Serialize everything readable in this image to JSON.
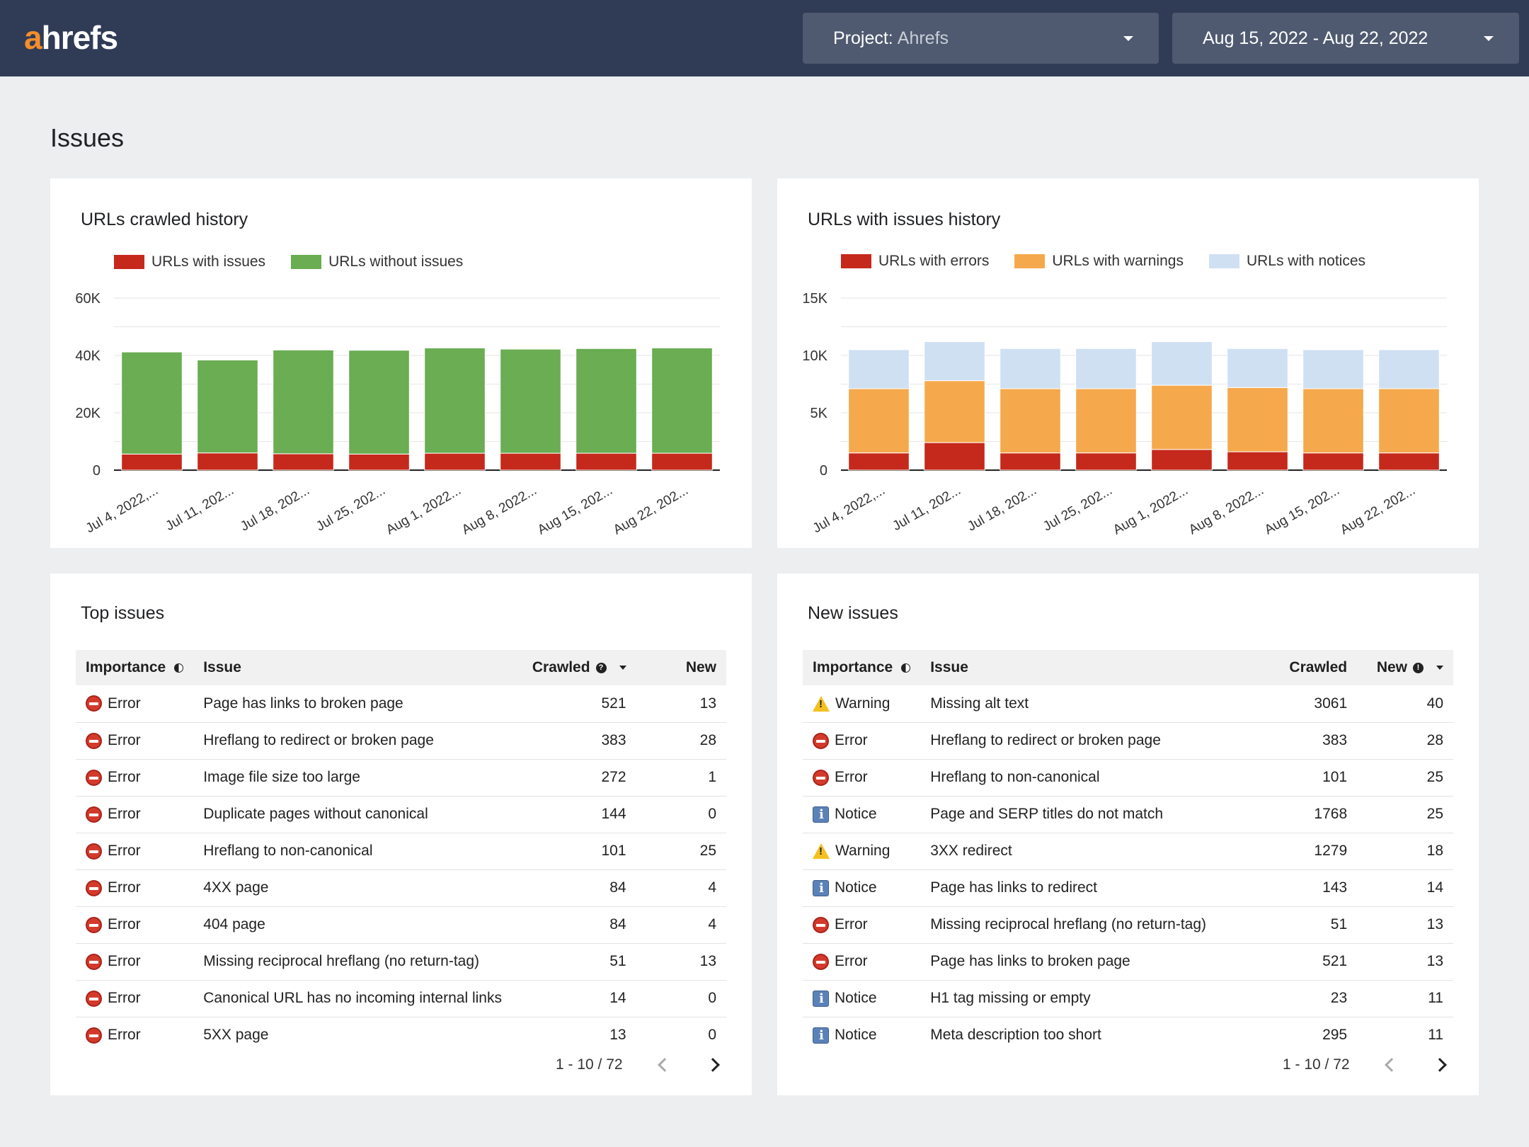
{
  "header": {
    "logo_accent": "a",
    "logo_rest": "hrefs",
    "project_label": "Project:",
    "project_value": "Ahrefs",
    "date_range": "Aug 15, 2022 - Aug 22, 2022"
  },
  "page_title": "Issues",
  "crawled_chart": {
    "title": "URLs crawled history",
    "chart_data": {
      "type": "bar",
      "stacked": true,
      "categories": [
        "Jul 4, 2022,...",
        "Jul 11, 202...",
        "Jul 18, 202...",
        "Jul 25, 202...",
        "Aug 1, 2022...",
        "Aug 8, 2022...",
        "Aug 15, 202...",
        "Aug 22, 202..."
      ],
      "series": [
        {
          "name": "URLs with issues",
          "color": "#c5291c",
          "values": [
            5600,
            6000,
            5700,
            5600,
            5900,
            5900,
            5900,
            5900
          ]
        },
        {
          "name": "URLs without issues",
          "color": "#6aad52",
          "values": [
            35600,
            32400,
            36200,
            36200,
            36700,
            36300,
            36500,
            36700
          ]
        }
      ],
      "yticks": [
        "0",
        "20K",
        "40K",
        "60K"
      ],
      "ylim": [
        0,
        60000
      ],
      "grid": true,
      "legend": "top-left"
    }
  },
  "issues_chart": {
    "title": "URLs with issues history",
    "chart_data": {
      "type": "bar",
      "stacked": true,
      "categories": [
        "Jul 4, 2022,...",
        "Jul 11, 202...",
        "Jul 18, 202...",
        "Jul 25, 202...",
        "Aug 1, 2022...",
        "Aug 8, 2022...",
        "Aug 15, 202...",
        "Aug 22, 202..."
      ],
      "series": [
        {
          "name": "URLs with errors",
          "color": "#c5291c",
          "values": [
            1500,
            2400,
            1500,
            1500,
            1800,
            1600,
            1500,
            1500
          ]
        },
        {
          "name": "URLs with warnings",
          "color": "#f5a94c",
          "values": [
            5600,
            5400,
            5600,
            5600,
            5600,
            5600,
            5600,
            5600
          ]
        },
        {
          "name": "URLs with notices",
          "color": "#cfe0f3",
          "values": [
            3400,
            3400,
            3500,
            3500,
            3800,
            3400,
            3400,
            3400
          ]
        }
      ],
      "yticks": [
        "0",
        "5K",
        "10K",
        "15K"
      ],
      "ylim": [
        0,
        15000
      ],
      "grid": true,
      "legend": "top-left"
    }
  },
  "top_issues": {
    "title": "Top issues",
    "columns": {
      "importance": "Importance",
      "issue": "Issue",
      "crawled": "Crawled",
      "new": "New"
    },
    "rows": [
      {
        "severity": "error",
        "importance": "Error",
        "issue": "Page has links to broken page",
        "crawled": "521",
        "new": "13"
      },
      {
        "severity": "error",
        "importance": "Error",
        "issue": "Hreflang to redirect or broken page",
        "crawled": "383",
        "new": "28"
      },
      {
        "severity": "error",
        "importance": "Error",
        "issue": "Image file size too large",
        "crawled": "272",
        "new": "1"
      },
      {
        "severity": "error",
        "importance": "Error",
        "issue": "Duplicate pages without canonical",
        "crawled": "144",
        "new": "0"
      },
      {
        "severity": "error",
        "importance": "Error",
        "issue": "Hreflang to non-canonical",
        "crawled": "101",
        "new": "25"
      },
      {
        "severity": "error",
        "importance": "Error",
        "issue": "4XX page",
        "crawled": "84",
        "new": "4"
      },
      {
        "severity": "error",
        "importance": "Error",
        "issue": "404 page",
        "crawled": "84",
        "new": "4"
      },
      {
        "severity": "error",
        "importance": "Error",
        "issue": "Missing reciprocal hreflang (no return-tag)",
        "crawled": "51",
        "new": "13"
      },
      {
        "severity": "error",
        "importance": "Error",
        "issue": "Canonical URL has no incoming internal links",
        "crawled": "14",
        "new": "0"
      },
      {
        "severity": "error",
        "importance": "Error",
        "issue": "5XX page",
        "crawled": "13",
        "new": "0"
      }
    ],
    "pagination": "1 - 10 / 72"
  },
  "new_issues": {
    "title": "New issues",
    "columns": {
      "importance": "Importance",
      "issue": "Issue",
      "crawled": "Crawled",
      "new": "New"
    },
    "rows": [
      {
        "severity": "warning",
        "importance": "Warning",
        "issue": "Missing alt text",
        "crawled": "3061",
        "new": "40"
      },
      {
        "severity": "error",
        "importance": "Error",
        "issue": "Hreflang to redirect or broken page",
        "crawled": "383",
        "new": "28"
      },
      {
        "severity": "error",
        "importance": "Error",
        "issue": "Hreflang to non-canonical",
        "crawled": "101",
        "new": "25"
      },
      {
        "severity": "notice",
        "importance": "Notice",
        "issue": "Page and SERP titles do not match",
        "crawled": "1768",
        "new": "25"
      },
      {
        "severity": "warning",
        "importance": "Warning",
        "issue": "3XX redirect",
        "crawled": "1279",
        "new": "18"
      },
      {
        "severity": "notice",
        "importance": "Notice",
        "issue": "Page has links to redirect",
        "crawled": "143",
        "new": "14"
      },
      {
        "severity": "error",
        "importance": "Error",
        "issue": "Missing reciprocal hreflang (no return-tag)",
        "crawled": "51",
        "new": "13"
      },
      {
        "severity": "error",
        "importance": "Error",
        "issue": "Page has links to broken page",
        "crawled": "521",
        "new": "13"
      },
      {
        "severity": "notice",
        "importance": "Notice",
        "issue": "H1 tag missing or empty",
        "crawled": "23",
        "new": "11"
      },
      {
        "severity": "notice",
        "importance": "Notice",
        "issue": "Meta description too short",
        "crawled": "295",
        "new": "11"
      }
    ],
    "pagination": "1 - 10 / 72"
  }
}
